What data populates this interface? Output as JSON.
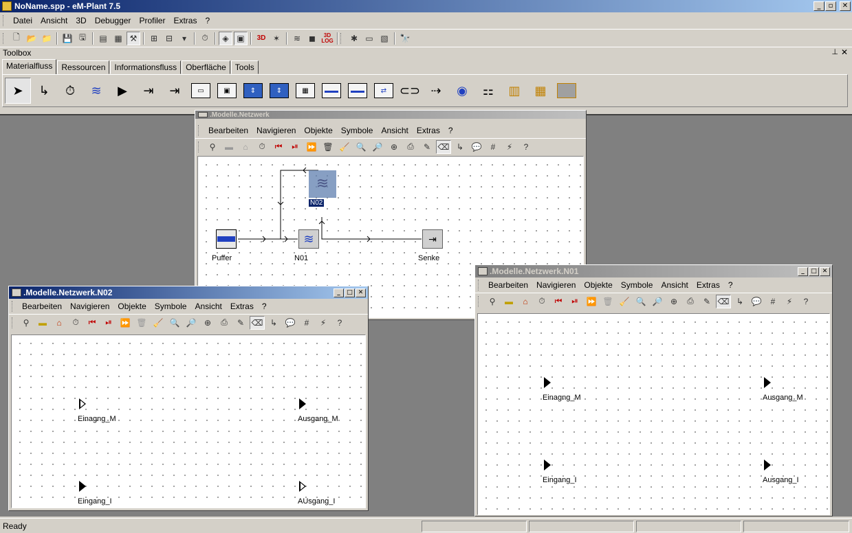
{
  "app": {
    "title": "NoName.spp - eM-Plant 7.5"
  },
  "main_menu": [
    "Datei",
    "Ansicht",
    "3D",
    "Debugger",
    "Profiler",
    "Extras",
    "?"
  ],
  "toolbox": {
    "title": "Toolbox",
    "tabs": [
      "Materialfluss",
      "Ressourcen",
      "Informationsfluss",
      "Oberfläche",
      "Tools"
    ],
    "active_tab": "Materialfluss"
  },
  "window_menu": [
    "Bearbeiten",
    "Navigieren",
    "Objekte",
    "Symbole",
    "Ansicht",
    "Extras",
    "?"
  ],
  "windows": {
    "netzwerk": {
      "title": ".Modelle.Netzwerk",
      "objects": {
        "puffer": "Puffer",
        "n01": "N01",
        "n02": "N02",
        "senke": "Senke"
      }
    },
    "n02": {
      "title": ".Modelle.Netzwerk.N02",
      "objects": {
        "in_m": "Einagng_M",
        "out_m": "Ausgang_M",
        "in_i": "Eingang_I",
        "out_i": "AUsgang_I"
      }
    },
    "n01": {
      "title": ".Modelle.Netzwerk.N01",
      "objects": {
        "in_m": "Einagng_M",
        "out_m": "Ausgang_M",
        "in_i": "Eingang_I",
        "out_i": "Ausgang_I"
      }
    }
  },
  "status": {
    "text": "Ready"
  },
  "icons": {
    "titlebar": [
      "minimize-icon",
      "restore-icon",
      "close-icon"
    ],
    "3d_label": "3D",
    "3d_log_label": "3D LOG"
  }
}
